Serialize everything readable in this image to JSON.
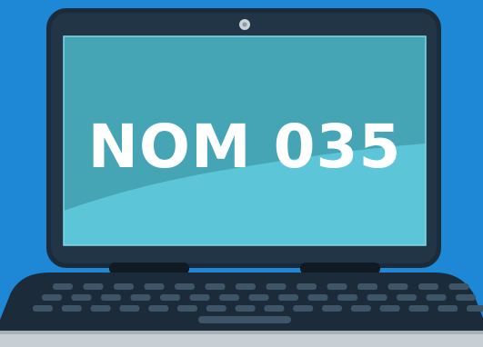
{
  "screen": {
    "headline": "NOM 035"
  },
  "colors": {
    "background": "#1e88d6",
    "laptop_body": "#1c2b3a",
    "screen_dark": "#46a5b5",
    "screen_light": "#5cc6d8",
    "key": "#3d5566",
    "base_silver": "#c8cfd4",
    "webcam": "#c9d2d8"
  },
  "icons": [
    "laptop-illustration",
    "webcam-icon",
    "keyboard-icon",
    "trackpad-icon"
  ]
}
